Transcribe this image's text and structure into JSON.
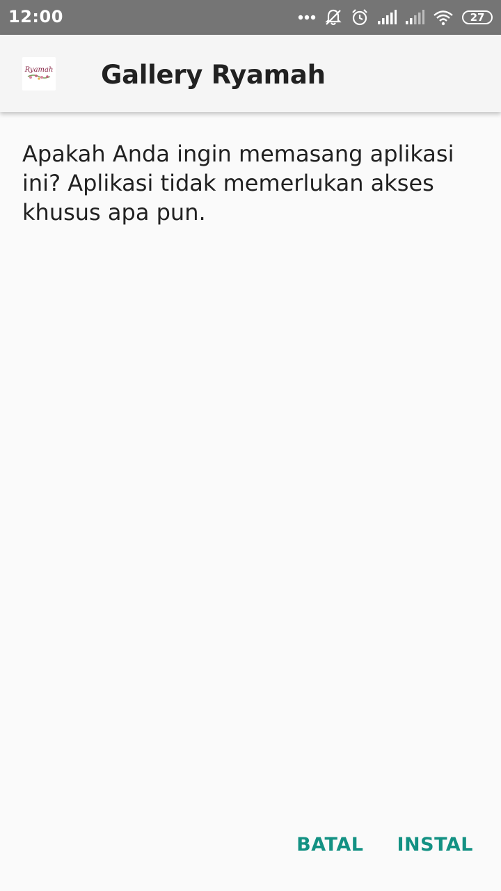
{
  "status_bar": {
    "time": "12:00",
    "battery_level": "27",
    "icons": [
      "more-dots-icon",
      "muted-bell-icon",
      "alarm-clock-icon",
      "signal-strength-icon",
      "signal-strength-weak-icon",
      "wifi-icon",
      "battery-icon"
    ]
  },
  "app_bar": {
    "title": "Gallery Ryamah",
    "icon_text": "Ryamah"
  },
  "dialog": {
    "message": "Apakah Anda ingin memasang aplikasi ini? Aplikasi tidak memerlukan akses khusus apa pun."
  },
  "actions": {
    "cancel_label": "BATAL",
    "install_label": "INSTAL"
  },
  "colors": {
    "accent": "#139183",
    "status_bar": "#757575",
    "app_bar": "#f5f5f5",
    "background": "#fafafa"
  }
}
